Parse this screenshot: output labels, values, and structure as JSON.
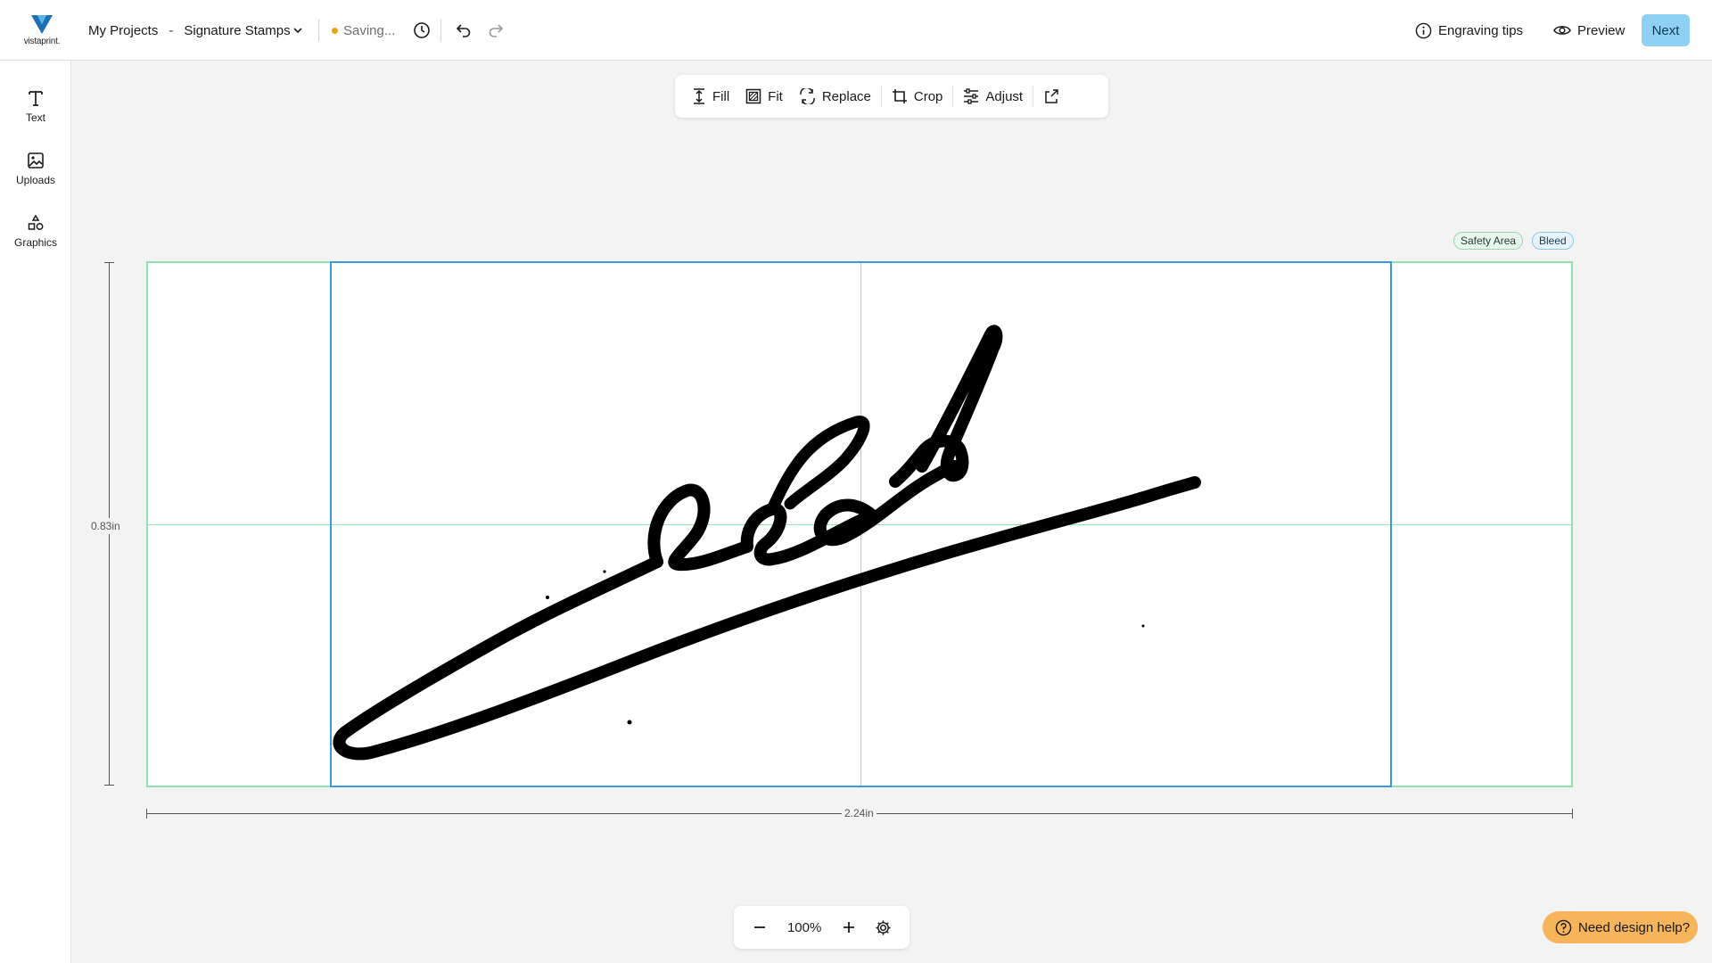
{
  "header": {
    "logo_text": "vistaprint.",
    "breadcrumb_root": "My Projects",
    "breadcrumb_separator": "-",
    "document_name": "Signature Stamps",
    "status": "Saving...",
    "engraving_tips": "Engraving tips",
    "preview": "Preview",
    "next": "Next"
  },
  "sidebar": {
    "items": [
      {
        "label": "Text",
        "icon": "text-icon"
      },
      {
        "label": "Uploads",
        "icon": "image-icon"
      },
      {
        "label": "Graphics",
        "icon": "shapes-icon"
      }
    ]
  },
  "toolbar": {
    "fill": "Fill",
    "fit": "Fit",
    "replace": "Replace",
    "crop": "Crop",
    "adjust": "Adjust"
  },
  "canvas": {
    "safety_area": "Safety Area",
    "bleed": "Bleed",
    "height_label": "0.83in",
    "width_label": "2.24in"
  },
  "zoom": {
    "value": "100%"
  },
  "help": {
    "label": "Need design help?"
  },
  "colors": {
    "accent": "#8fd1f2",
    "selection": "#3a9ad9",
    "guides": "#8ee3ae",
    "help": "#f7b55b",
    "saving_dot": "#e8a317"
  }
}
